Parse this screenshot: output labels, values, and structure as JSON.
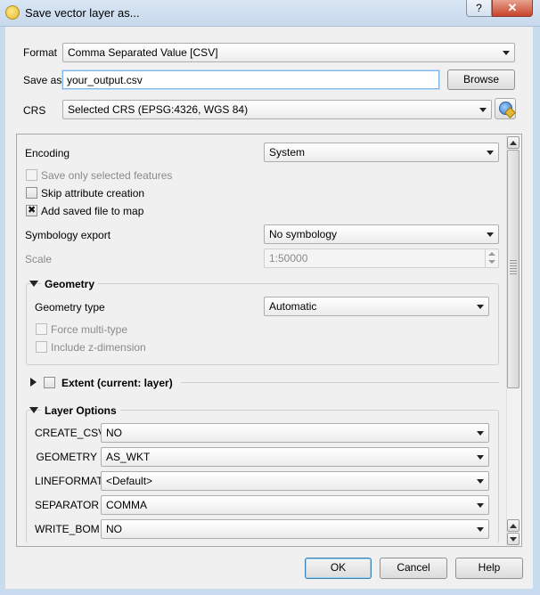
{
  "window": {
    "title": "Save vector layer as...",
    "help_label": "?",
    "close_label": "✕"
  },
  "format": {
    "label": "Format",
    "value": "Comma Separated Value [CSV]"
  },
  "save_as": {
    "label": "Save as",
    "value": "your_output.csv",
    "browse_label": "Browse"
  },
  "crs": {
    "label": "CRS",
    "value": "Selected CRS (EPSG:4326, WGS 84)"
  },
  "encoding": {
    "label": "Encoding",
    "value": "System"
  },
  "checkboxes": {
    "save_selected": {
      "label": "Save only selected features",
      "checked": false,
      "enabled": false
    },
    "skip_attr": {
      "label": "Skip attribute creation",
      "checked": false,
      "enabled": true
    },
    "add_to_map": {
      "label": "Add saved file to map",
      "checked": true,
      "enabled": true
    }
  },
  "symbology": {
    "label": "Symbology export",
    "value": "No symbology"
  },
  "scale": {
    "label": "Scale",
    "value": "1:50000"
  },
  "geometry": {
    "title": "Geometry",
    "type_label": "Geometry type",
    "type_value": "Automatic",
    "force_multi_label": "Force multi-type",
    "include_z_label": "Include z-dimension"
  },
  "extent": {
    "title": "Extent (current: layer)"
  },
  "layer_options": {
    "title": "Layer Options",
    "rows": [
      {
        "name": "CREATE_CSVT",
        "value": "NO"
      },
      {
        "name": "GEOMETRY",
        "value": "AS_WKT"
      },
      {
        "name": "LINEFORMAT",
        "value": "<Default>"
      },
      {
        "name": "SEPARATOR",
        "value": "COMMA"
      },
      {
        "name": "WRITE_BOM",
        "value": "NO"
      }
    ]
  },
  "buttons": {
    "ok": "OK",
    "cancel": "Cancel",
    "help": "Help"
  }
}
